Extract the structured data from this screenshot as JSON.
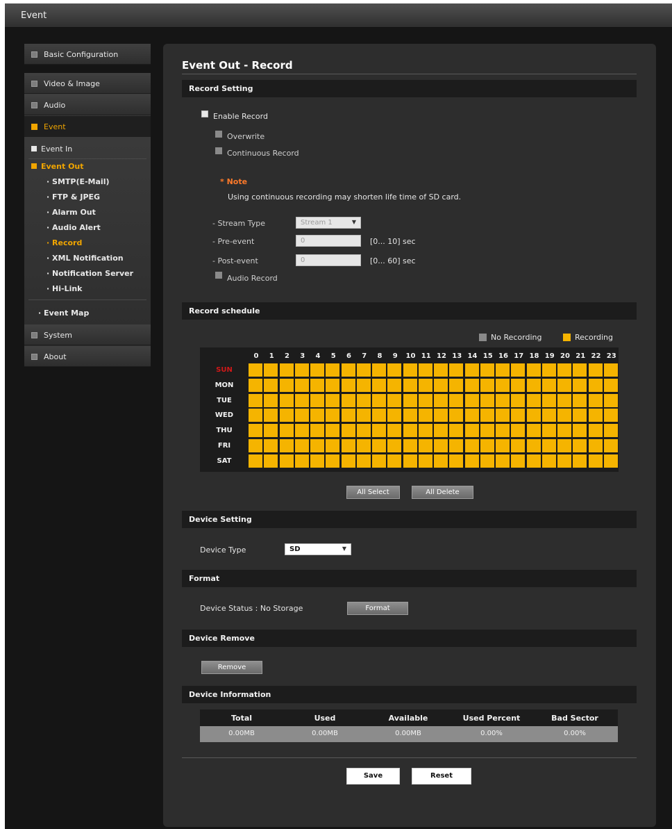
{
  "window": {
    "title": "Event"
  },
  "sidebar": {
    "basic_configuration": "Basic Configuration",
    "video_image": "Video & Image",
    "audio": "Audio",
    "event": "Event",
    "event_in": "Event In",
    "event_out": "Event Out",
    "event_out_items": [
      "SMTP(E-Mail)",
      "FTP & JPEG",
      "Alarm Out",
      "Audio Alert",
      "Record",
      "XML Notification",
      "Notification Server",
      "Hi-Link"
    ],
    "event_map": "Event Map",
    "system": "System",
    "about": "About",
    "active_item": "Record"
  },
  "page": {
    "title": "Event Out - Record"
  },
  "record_setting": {
    "header": "Record Setting",
    "enable_record": "Enable Record",
    "overwrite": "Overwrite",
    "continuous_record": "Continuous Record",
    "note_title": "* Note",
    "note_text": "Using continuous recording may shorten life time of SD card.",
    "stream_type_label": "- Stream Type",
    "stream_type_value": "Stream 1",
    "pre_event_label": "- Pre-event",
    "pre_event_value": "0",
    "pre_event_range": "[0... 10] sec",
    "post_event_label": "- Post-event",
    "post_event_value": "0",
    "post_event_range": "[0... 60] sec",
    "audio_record": "Audio Record"
  },
  "record_schedule": {
    "header": "Record schedule",
    "legend_no_recording": "No Recording",
    "legend_recording": "Recording",
    "hours": [
      "0",
      "1",
      "2",
      "3",
      "4",
      "5",
      "6",
      "7",
      "8",
      "9",
      "10",
      "11",
      "12",
      "13",
      "14",
      "15",
      "16",
      "17",
      "18",
      "19",
      "20",
      "21",
      "22",
      "23"
    ],
    "days": [
      "SUN",
      "MON",
      "TUE",
      "WED",
      "THU",
      "FRI",
      "SAT"
    ],
    "all_hours_recording": true,
    "all_select": "All Select",
    "all_delete": "All Delete"
  },
  "device_setting": {
    "header": "Device Setting",
    "device_type_label": "Device Type",
    "device_type_value": "SD"
  },
  "format": {
    "header": "Format",
    "device_status": "Device Status : No Storage",
    "format_button": "Format"
  },
  "device_remove": {
    "header": "Device Remove",
    "remove_button": "Remove"
  },
  "device_information": {
    "header": "Device Information",
    "columns": [
      "Total",
      "Used",
      "Available",
      "Used Percent",
      "Bad Sector"
    ],
    "values": [
      "0.00MB",
      "0.00MB",
      "0.00MB",
      "0.00%",
      "0.00%"
    ]
  },
  "footer": {
    "save": "Save",
    "reset": "Reset"
  },
  "colors": {
    "accent": "#f0a500",
    "recording": "#f5b400",
    "no_recording": "#8a8a8a",
    "note": "#ff7a2a",
    "sunday": "#d01818"
  }
}
